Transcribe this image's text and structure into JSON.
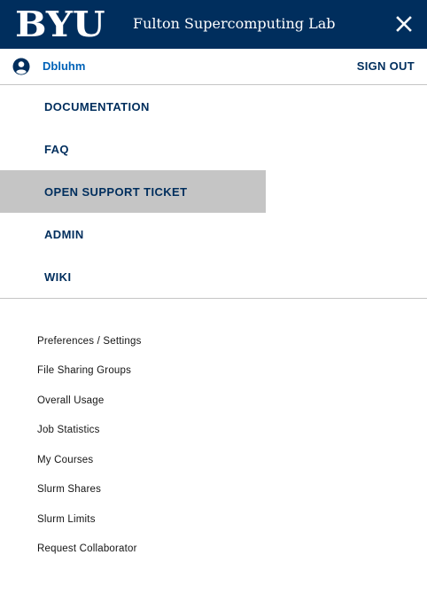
{
  "header": {
    "logo_text": "BYU",
    "site_title": "Fulton Supercomputing Lab",
    "close_icon": "close-icon"
  },
  "user": {
    "icon": "user-circle-icon",
    "name": "Dbluhm",
    "sign_out": "SIGN OUT"
  },
  "main_nav": {
    "items": [
      {
        "label": "DOCUMENTATION",
        "active": false
      },
      {
        "label": "FAQ",
        "active": false
      },
      {
        "label": "OPEN SUPPORT TICKET",
        "active": true
      },
      {
        "label": "ADMIN",
        "active": false
      },
      {
        "label": "WIKI",
        "active": false
      }
    ]
  },
  "sub_nav": {
    "items": [
      "Preferences / Settings",
      "File Sharing Groups",
      "Overall Usage",
      "Job Statistics",
      "My Courses",
      "Slurm Shares",
      "Slurm Limits",
      "Request Collaborator"
    ]
  },
  "colors": {
    "brand_navy": "#002e5d",
    "link_blue": "#0062b8",
    "active_bg": "#c5c5c5",
    "divider": "#c5c5c5"
  }
}
